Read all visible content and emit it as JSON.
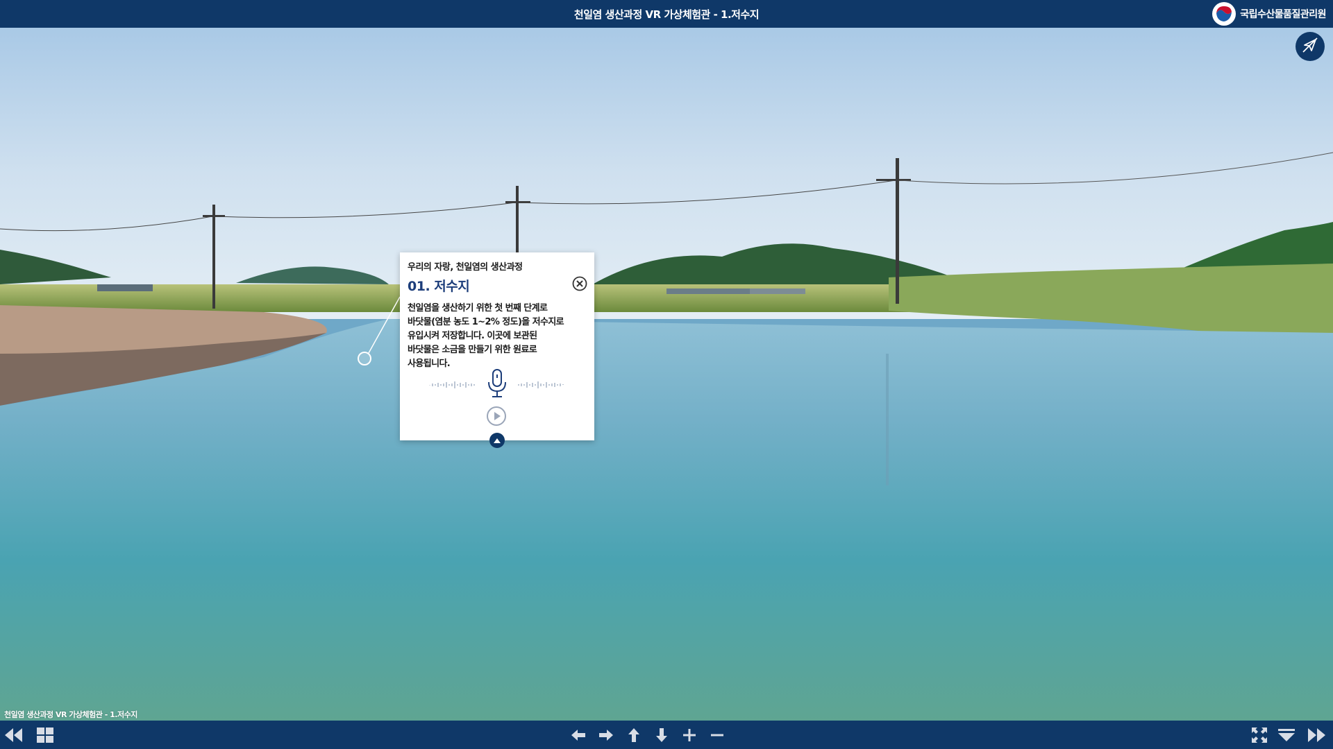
{
  "header": {
    "title": "천일염 생산과정 VR 가상체험관 - 1.저수지",
    "org_name": "국립수산물품질관리원",
    "emblem_icon": "korea-government-emblem-icon"
  },
  "scene": {
    "description_icon": "panorama-reservoir",
    "gyro_icon": "gyro-off-icon"
  },
  "popup": {
    "subtitle": "우리의 자랑, 천일염의 생산과정",
    "heading": "01. 저수지",
    "body": "천일염을 생산하기 위한 첫 번째 단계로\n바닷물(염분 농도 1~2% 정도)을 저수지로\n유입시켜 저장합니다. 이곳에 보관된\n바닷물은 소금을 만들기 위한 원료로\n사용됩니다.",
    "icons": {
      "close": "close-circle-icon",
      "mic": "microphone-icon",
      "play": "play-circle-icon",
      "collapse": "collapse-up-icon"
    }
  },
  "footer": {
    "caption": "천일염 생산과정 VR 가상체험관 - 1.저수지",
    "buttons": {
      "prev_scene": "double-chevron-left-icon",
      "thumbnails": "grid-icon",
      "left": "arrow-left-icon",
      "right": "arrow-right-icon",
      "up": "arrow-up-icon",
      "down": "arrow-down-icon",
      "zoom_in": "plus-icon",
      "zoom_out": "minus-icon",
      "fullscreen": "fullscreen-icon",
      "hide_bar": "hide-bar-icon",
      "next_scene": "double-chevron-right-icon"
    }
  },
  "colors": {
    "bar": "#0f3868",
    "heading": "#1c3d7a"
  }
}
